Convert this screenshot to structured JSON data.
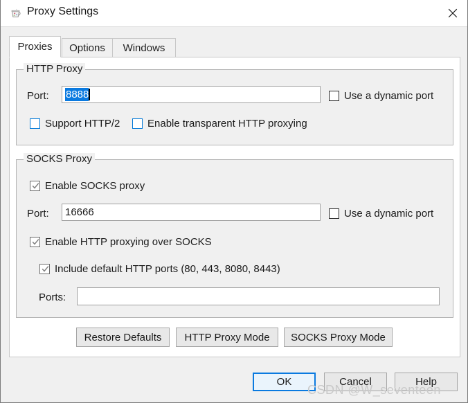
{
  "window": {
    "title": "Proxy Settings",
    "icon": "charles-cup-icon",
    "close_label": "✕"
  },
  "tabs": [
    {
      "label": "Proxies",
      "active": true
    },
    {
      "label": "Options",
      "active": false
    },
    {
      "label": "Windows",
      "active": false
    }
  ],
  "http_proxy": {
    "group_title": "HTTP Proxy",
    "port_label": "Port:",
    "port_value": "8888",
    "port_value_selected": true,
    "dynamic_port": {
      "label": "Use a dynamic port",
      "checked": false,
      "state": "disabled"
    },
    "support_http2": {
      "label": "Support HTTP/2",
      "checked": false,
      "state": "enabled"
    },
    "transparent": {
      "label": "Enable transparent HTTP proxying",
      "checked": false,
      "state": "enabled"
    }
  },
  "socks_proxy": {
    "group_title": "SOCKS Proxy",
    "enable": {
      "label": "Enable SOCKS proxy",
      "checked": true,
      "state": "greyed"
    },
    "port_label": "Port:",
    "port_value": "16666",
    "dynamic_port": {
      "label": "Use a dynamic port",
      "checked": false,
      "state": "disabled"
    },
    "http_over_socks": {
      "label": "Enable HTTP proxying over SOCKS",
      "checked": true,
      "state": "greyed"
    },
    "include_default_ports": {
      "label": "Include default HTTP ports (80, 443, 8080, 8443)",
      "checked": true,
      "state": "greyed"
    },
    "ports_label": "Ports:",
    "ports_value": ""
  },
  "action_buttons": [
    {
      "label": "Restore Defaults"
    },
    {
      "label": "HTTP Proxy Mode"
    },
    {
      "label": "SOCKS Proxy Mode"
    }
  ],
  "dialog_buttons": {
    "ok": "OK",
    "cancel": "Cancel",
    "help": "Help"
  },
  "watermark": "CSDN @W_seventeen",
  "colors": {
    "accent": "#0078d7",
    "selection": "#0a7ae0",
    "dialog_bg": "#f0f0f0",
    "panel_bg": "#ffffff"
  }
}
